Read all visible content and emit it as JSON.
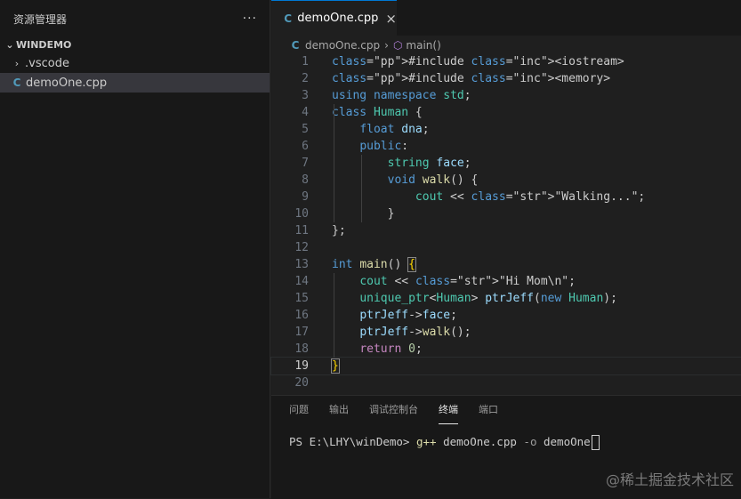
{
  "sidebar": {
    "title": "资源管理器",
    "more": "···",
    "folder": "WINDEMO",
    "items": [
      {
        "label": ".vscode"
      },
      {
        "label": "demoOne.cpp",
        "icon": "C"
      }
    ]
  },
  "tab": {
    "label": "demoOne.cpp",
    "icon": "C",
    "close": "×"
  },
  "breadcrumb": {
    "file": "demoOne.cpp",
    "separator": "›",
    "symbol": "main()"
  },
  "code_lines": [
    "#include <iostream>",
    "#include <memory>",
    "using namespace std;",
    "class Human {",
    "    float dna;",
    "    public:",
    "        string face;",
    "        void walk() {",
    "            cout << \"Walking...\";",
    "        }",
    "};",
    "",
    "int main() {",
    "    cout << \"Hi Mom\\n\";",
    "    unique_ptr<Human> ptrJeff(new Human);",
    "    ptrJeff->face;",
    "    ptrJeff->walk();",
    "    return 0;",
    "}",
    ""
  ],
  "line_numbers": [
    "1",
    "2",
    "3",
    "4",
    "5",
    "6",
    "7",
    "8",
    "9",
    "10",
    "11",
    "12",
    "13",
    "14",
    "15",
    "16",
    "17",
    "18",
    "19",
    "20"
  ],
  "current_line": 19,
  "panel": {
    "tabs": [
      "问题",
      "输出",
      "调试控制台",
      "终端",
      "端口"
    ],
    "active_tab": "终端",
    "terminal": {
      "prompt": "PS E:\\LHY\\winDemo> ",
      "command": "g++",
      "args": " demoOne.cpp ",
      "flag": "-o",
      "target": " demoOne"
    }
  },
  "watermark": "@稀土掘金技术社区",
  "colors": {
    "accent": "#0078d4",
    "background": "#1e1e1e",
    "sidebar": "#181818"
  }
}
